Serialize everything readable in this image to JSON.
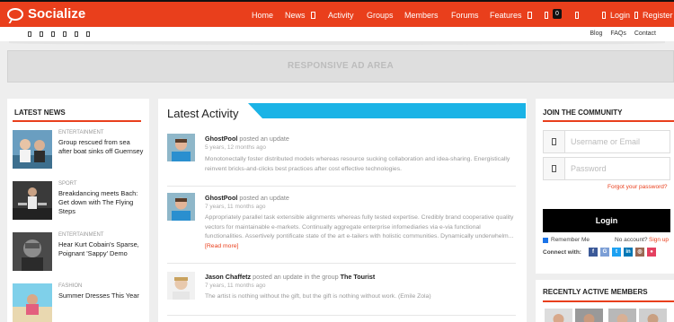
{
  "header": {
    "app_name": "Socialize",
    "nav": [
      {
        "label": "Home"
      },
      {
        "label": "News"
      },
      {
        "label": "Activity"
      },
      {
        "label": "Groups"
      },
      {
        "label": "Members"
      },
      {
        "label": "Forums"
      },
      {
        "label": "Features"
      }
    ],
    "cart_count": "0",
    "login_label": "Login",
    "register_label": "Register"
  },
  "subbar": {
    "social_icons": [
      "twitter-icon",
      "facebook-icon",
      "google-plus-icon",
      "linkedin-icon",
      "youtube-icon",
      "rss-icon"
    ],
    "links": [
      "Blog",
      "FAQs",
      "Contact"
    ]
  },
  "ad": {
    "label": "RESPONSIVE AD AREA"
  },
  "latest_news": {
    "title": "LATEST NEWS",
    "items": [
      {
        "category": "ENTERTAINMENT",
        "title": "Group rescued from sea after boat sinks off Guernsey"
      },
      {
        "category": "SPORT",
        "title": "Breakdancing meets Bach: Get down with The Flying Steps"
      },
      {
        "category": "ENTERTAINMENT",
        "title": "Hear Kurt Cobain's Sparse, Poignant 'Sappy' Demo"
      },
      {
        "category": "FASHION",
        "title": "Summer Dresses This Year"
      }
    ]
  },
  "activity": {
    "title": "Latest Activity",
    "items": [
      {
        "name": "GhostPool",
        "action": "posted an update",
        "group_prefix": "",
        "group": "",
        "time": "5 years, 12 months ago",
        "body": "Monotonectally foster distributed models whereas resource sucking collaboration and idea-sharing. Energistically reinvent bricks-and-clicks best practices after cost effective technologies.",
        "more": ""
      },
      {
        "name": "GhostPool",
        "action": "posted an update",
        "group_prefix": "",
        "group": "",
        "time": "7 years, 11 months ago",
        "body": "Appropriately parallel task extensible alignments whereas fully tested expertise. Credibly brand cooperative quality vectors for maintainable e-markets. Continually aggregate enterprise infomediaries via e-via functional functionalities. Assertively pontificate state of the art e-tailers with holistic communities. Dynamically underwhelm...",
        "more": "[Read more]"
      },
      {
        "name": "Jason Chaffetz",
        "action": "posted an update in the group",
        "group_prefix": "",
        "group": "The Tourist",
        "time": "7 years, 11 months ago",
        "body": "The artist is nothing without the gift, but the gift is nothing without work. (Emile Zola)",
        "more": ""
      }
    ]
  },
  "community": {
    "title": "JOIN THE COMMUNITY",
    "username_placeholder": "Username or Email",
    "password_placeholder": "Password",
    "forgot": "Forgot your password?",
    "login_button": "Login",
    "remember": "Remember Me",
    "no_account": "No account?",
    "signup": "Sign up",
    "connect": "Connect with:"
  },
  "members": {
    "title": "RECENTLY ACTIVE MEMBERS"
  },
  "colors": {
    "brand": "#e93f1c",
    "accent": "#1ab3e6"
  }
}
